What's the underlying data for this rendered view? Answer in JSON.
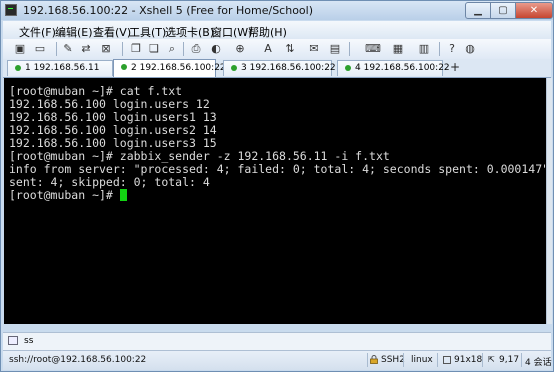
{
  "window": {
    "title": "192.168.56.100:22 - Xshell 5 (Free for Home/School)"
  },
  "menu": [
    "文件(F)",
    "编辑(E)",
    "查看(V)",
    "工具(T)",
    "选项卡(B)",
    "窗口(W)",
    "帮助(H)"
  ],
  "toolbar_icons": [
    "new-session-icon",
    "open-folder-icon",
    "properties-icon",
    "reconnect-icon",
    "disconnect-icon",
    "copy-icon",
    "paste-icon",
    "find-icon",
    "print-icon",
    "color-scheme-icon",
    "font-icon",
    "transfer-icon",
    "keyboard-icon",
    "script-icon",
    "compose-icon",
    "layout-icon",
    "tab-list-icon",
    "help-icon",
    "about-icon"
  ],
  "tabs": [
    {
      "label": "1 192.168.56.11",
      "active": false
    },
    {
      "label": "2 192.168.56.100:22",
      "active": true
    },
    {
      "label": "3 192.168.56.100:22",
      "active": false
    },
    {
      "label": "4 192.168.56.100:22",
      "active": false
    }
  ],
  "tab_add_label": "+",
  "terminal": {
    "lines": [
      "[root@muban ~]# cat f.txt",
      "192.168.56.100 login.users 12",
      "192.168.56.100 login.users1 13",
      "192.168.56.100 login.users2 14",
      "192.168.56.100 login.users3 15",
      "[root@muban ~]# zabbix_sender -z 192.168.56.11 -i f.txt",
      "info from server: \"processed: 4; failed: 0; total: 4; seconds spent: 0.000147\"",
      "sent: 4; skipped: 0; total: 4"
    ],
    "prompt": "[root@muban ~]# "
  },
  "session": {
    "label": "ss"
  },
  "status": {
    "connection": "ssh://root@192.168.56.100:22",
    "protocol": "SSH2",
    "term_type": "linux",
    "size": "91x18",
    "cursor_pos": "9,17",
    "sessions": "4 会话"
  },
  "colors": {
    "terminal_bg": "#000000",
    "terminal_fg": "#dcdcdc",
    "cursor": "#12d312",
    "active_dot": "#2ca02c"
  }
}
